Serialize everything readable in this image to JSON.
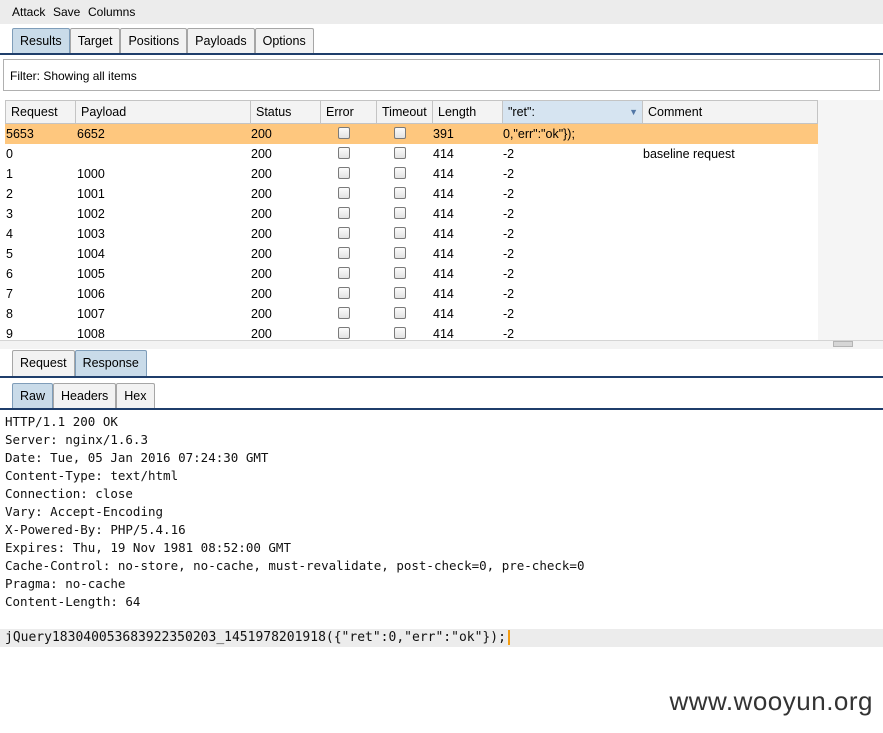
{
  "menu": [
    "Attack",
    "Save",
    "Columns"
  ],
  "main_tabs": [
    {
      "label": "Results",
      "selected": true
    },
    {
      "label": "Target",
      "selected": false
    },
    {
      "label": "Positions",
      "selected": false
    },
    {
      "label": "Payloads",
      "selected": false
    },
    {
      "label": "Options",
      "selected": false
    }
  ],
  "filter_text": "Filter:  Showing all items",
  "table": {
    "columns": [
      "Request",
      "Payload",
      "Status",
      "Error",
      "Timeout",
      "Length",
      "\"ret\":",
      "Comment"
    ],
    "sort_arrow": "▼",
    "rows": [
      {
        "request": "5653",
        "payload": "6652",
        "status": "200",
        "length": "391",
        "ret": "0,\"err\":\"ok\"});",
        "comment": ""
      },
      {
        "request": "0",
        "payload": "",
        "status": "200",
        "length": "414",
        "ret": "-2",
        "comment": "baseline request"
      },
      {
        "request": "1",
        "payload": "1000",
        "status": "200",
        "length": "414",
        "ret": "-2",
        "comment": ""
      },
      {
        "request": "2",
        "payload": "1001",
        "status": "200",
        "length": "414",
        "ret": "-2",
        "comment": ""
      },
      {
        "request": "3",
        "payload": "1002",
        "status": "200",
        "length": "414",
        "ret": "-2",
        "comment": ""
      },
      {
        "request": "4",
        "payload": "1003",
        "status": "200",
        "length": "414",
        "ret": "-2",
        "comment": ""
      },
      {
        "request": "5",
        "payload": "1004",
        "status": "200",
        "length": "414",
        "ret": "-2",
        "comment": ""
      },
      {
        "request": "6",
        "payload": "1005",
        "status": "200",
        "length": "414",
        "ret": "-2",
        "comment": ""
      },
      {
        "request": "7",
        "payload": "1006",
        "status": "200",
        "length": "414",
        "ret": "-2",
        "comment": ""
      },
      {
        "request": "8",
        "payload": "1007",
        "status": "200",
        "length": "414",
        "ret": "-2",
        "comment": ""
      },
      {
        "request": "9",
        "payload": "1008",
        "status": "200",
        "length": "414",
        "ret": "-2",
        "comment": ""
      }
    ]
  },
  "detail_tabs": [
    {
      "label": "Request",
      "selected": false
    },
    {
      "label": "Response",
      "selected": true
    }
  ],
  "view_tabs": [
    {
      "label": "Raw",
      "selected": true
    },
    {
      "label": "Headers",
      "selected": false
    },
    {
      "label": "Hex",
      "selected": false
    }
  ],
  "response_lines": [
    "HTTP/1.1 200 OK",
    "Server: nginx/1.6.3",
    "Date: Tue, 05 Jan 2016 07:24:30 GMT",
    "Content-Type: text/html",
    "Connection: close",
    "Vary: Accept-Encoding",
    "X-Powered-By: PHP/5.4.16",
    "Expires: Thu, 19 Nov 1981 08:52:00 GMT",
    "Cache-Control: no-store, no-cache, must-revalidate, post-check=0, pre-check=0",
    "Pragma: no-cache",
    "Content-Length: 64"
  ],
  "response_body": "jQuery183040053683922350203_1451978201918({\"ret\":0,\"err\":\"ok\"});",
  "watermark": "www.wooyun.org",
  "colors": {
    "highlight_row": "#fec77e",
    "selected_tab": "#c9dbe9",
    "rule": "#1f3e6b"
  }
}
